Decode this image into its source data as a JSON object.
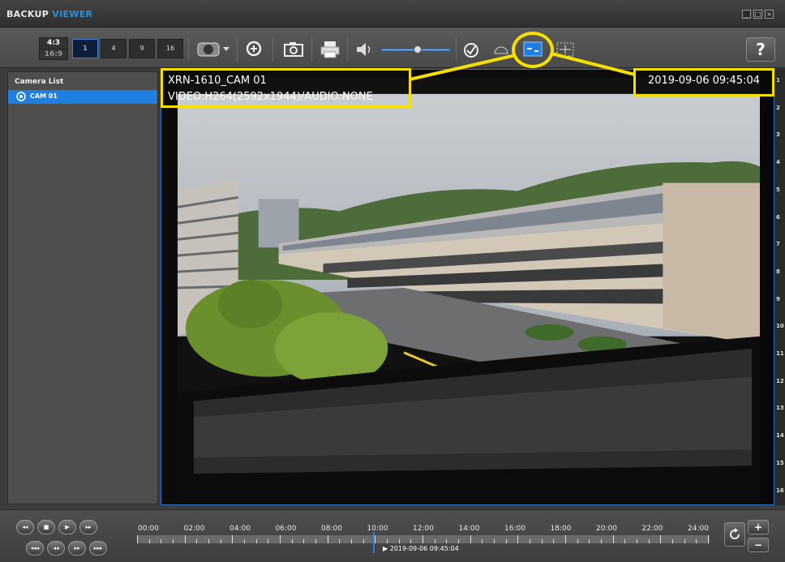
{
  "app": {
    "title_part1": "BACKUP",
    "title_part2": "VIEWER",
    "window_buttons": [
      "_",
      "□",
      "×"
    ]
  },
  "toolbar": {
    "aspect_ratios": [
      "4:3",
      "16:9"
    ],
    "layouts": [
      "1",
      "4",
      "9",
      "16"
    ],
    "volume_level": 0.5,
    "help_label": "?"
  },
  "camera_list": {
    "title": "Camera List",
    "items": [
      {
        "label": "CAM 01",
        "selected": true
      }
    ]
  },
  "video": {
    "camera_name": "XRN-1610_CAM 01",
    "codec_info": "VIDEO:H264(2592x1944)/AUDIO:NONE",
    "timestamp": "2019-09-06 09:45:04",
    "hour_marks": [
      "1",
      "2",
      "3",
      "4",
      "5",
      "6",
      "7",
      "8",
      "9",
      "10",
      "11",
      "12",
      "13",
      "14",
      "15",
      "16"
    ]
  },
  "timeline": {
    "ticks": [
      "00:00",
      "02:00",
      "04:00",
      "06:00",
      "08:00",
      "10:00",
      "12:00",
      "14:00",
      "16:00",
      "18:00",
      "20:00",
      "22:00",
      "24:00"
    ],
    "current_label": "2019-09-06 09:45:04",
    "playhead_hour": 9.75
  },
  "colors": {
    "accent": "#1f7fe0",
    "highlight": "#f4e000"
  }
}
